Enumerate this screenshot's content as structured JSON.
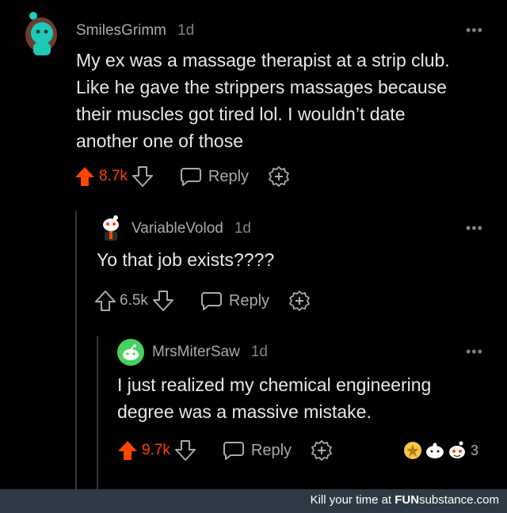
{
  "comments": [
    {
      "username": "SmilesGrimm",
      "age": "1d",
      "more": "•••",
      "text_lines": [
        "My ex was a massage therapist at a strip club.",
        "Like he gave the strippers massages because",
        "their muscles got tired lol. I wouldn’t date",
        "another one of those"
      ],
      "votes": "8.7k",
      "vote_state": "upvoted",
      "reply_label": "Reply"
    },
    {
      "username": "VariableVolod",
      "age": "1d",
      "more": "•••",
      "text_lines": [
        "Yo that job exists????"
      ],
      "votes": "6.5k",
      "vote_state": "neutral",
      "reply_label": "Reply"
    },
    {
      "username": "MrsMiterSaw",
      "age": "1d",
      "more": "•••",
      "text_lines": [
        "I just realized my chemical engineering",
        "degree was a massive mistake."
      ],
      "votes": "9.7k",
      "vote_state": "upvoted",
      "reply_label": "Reply",
      "award_count": "3"
    }
  ],
  "footer": {
    "prefix": "Kill your time at ",
    "brand_bold": "FUN",
    "brand_rest": "substance",
    "suffix": ".com"
  },
  "colors": {
    "upvote": "#ff4500",
    "text": "#e6e8ea",
    "muted": "#a8aaab",
    "footer_bg": "#2d3a45"
  },
  "icons": [
    "upvote-arrow-icon",
    "downvote-arrow-icon",
    "reply-bubble-icon",
    "award-plus-icon",
    "more-dots-icon"
  ]
}
